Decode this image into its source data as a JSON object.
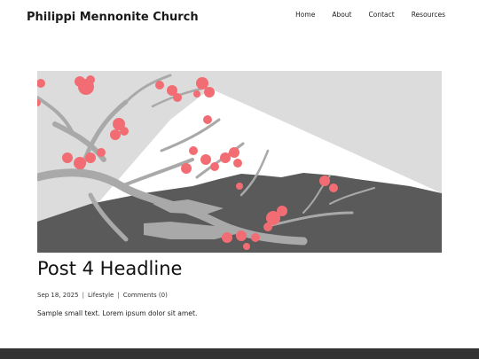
{
  "site": {
    "title": "Philippi Mennonite Church"
  },
  "nav": {
    "items": [
      {
        "label": "Home"
      },
      {
        "label": "About"
      },
      {
        "label": "Contact"
      },
      {
        "label": "Resources"
      }
    ]
  },
  "post": {
    "title": "Post 4 Headline",
    "date": "Sep 18, 2025",
    "separator": "|",
    "category": "Lifestyle",
    "comments": "Comments (0)",
    "excerpt": "Sample small text. Lorem ipsum dolor sit amet."
  },
  "colors": {
    "blossom": "#f26d73",
    "branch": "#a9a9a9",
    "mountain_dark": "#5a5a5a",
    "sky": "#dcdcdc",
    "snow": "#ffffff",
    "footer": "#333333"
  }
}
